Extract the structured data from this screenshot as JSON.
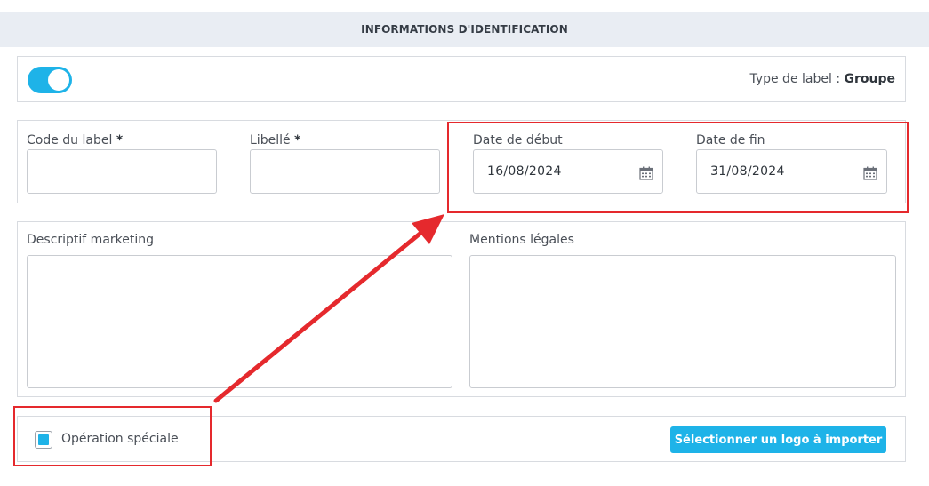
{
  "section": {
    "title": "INFORMATIONS D'IDENTIFICATION"
  },
  "top_bar": {
    "toggle_state": "on",
    "label_type_prefix": "Type de label : ",
    "label_type_value": "Groupe"
  },
  "fields": {
    "code_label": {
      "label": "Code du label",
      "required_mark": "*",
      "value": ""
    },
    "libelle": {
      "label": "Libellé",
      "required_mark": "*",
      "value": ""
    },
    "date_debut": {
      "label": "Date de début",
      "value": "16/08/2024",
      "icon": "calendar-icon"
    },
    "date_fin": {
      "label": "Date de fin",
      "value": "31/08/2024",
      "icon": "calendar-icon"
    }
  },
  "text_areas": {
    "descriptif": {
      "label": "Descriptif marketing",
      "value": ""
    },
    "mentions": {
      "label": "Mentions légales",
      "value": ""
    }
  },
  "bottom": {
    "checkbox_label": "Opération spéciale",
    "checkbox_checked": true,
    "button_label": "Sélectionner un logo à importer"
  },
  "colors": {
    "accent": "#1eb3e8",
    "annotation": "#e5292d",
    "header_bg": "#e9edf3"
  }
}
